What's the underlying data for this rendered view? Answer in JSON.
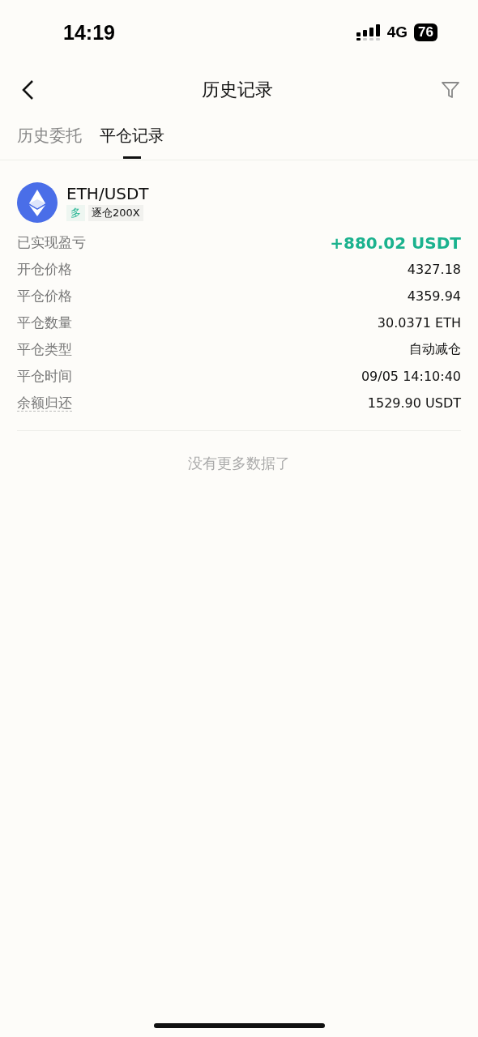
{
  "status_bar": {
    "time": "14:19",
    "network": "4G",
    "battery": "76"
  },
  "header": {
    "title": "历史记录"
  },
  "tabs": [
    {
      "label": "历史委托",
      "selected": false
    },
    {
      "label": "平仓记录",
      "selected": true
    }
  ],
  "record": {
    "pair": "ETH/USDT",
    "side": "多",
    "margin": "逐仓200X",
    "fields": [
      {
        "kind": "pnl",
        "label": "已实现盈亏",
        "value": "+880.02 USDT"
      },
      {
        "kind": "plain",
        "label": "开仓价格",
        "value": "4327.18"
      },
      {
        "kind": "plain",
        "label": "平仓价格",
        "value": "4359.94"
      },
      {
        "kind": "plain",
        "label": "平仓数量",
        "value": "30.0371 ETH"
      },
      {
        "kind": "plain",
        "label": "平仓类型",
        "value": "自动减仓"
      },
      {
        "kind": "plain",
        "label": "平仓时间",
        "value": "09/05 14:10:40"
      },
      {
        "kind": "hint",
        "label": "余额归还",
        "value": "1529.90 USDT"
      }
    ]
  },
  "footer": {
    "text": "没有更多数据了"
  }
}
